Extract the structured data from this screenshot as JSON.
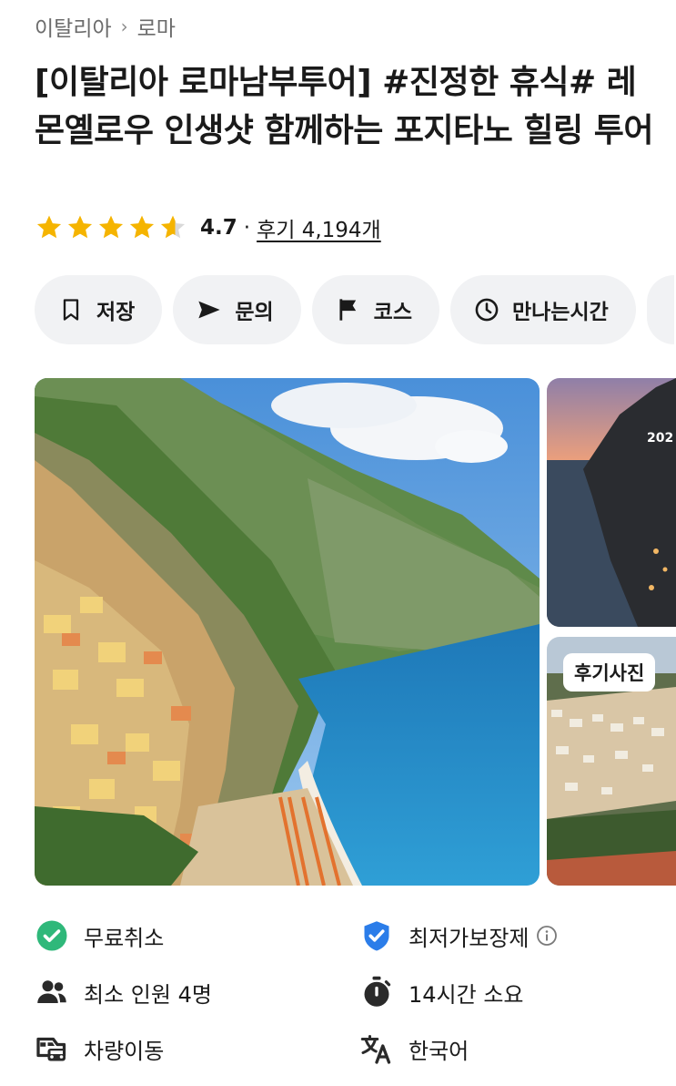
{
  "breadcrumb": {
    "country": "이탈리아",
    "city": "로마",
    "separator": "›"
  },
  "title": "[이탈리아 로마남부투어] #진정한 휴식# 레몬옐로우 인생샷 함께하는 포지타노 힐링 투어",
  "rating": {
    "stars": 4.7,
    "score": "4.7",
    "dot": "·",
    "reviews": "후기 4,194개",
    "star_color": "#f5b400"
  },
  "actions": [
    {
      "label": "저장",
      "icon": "bookmark-icon"
    },
    {
      "label": "문의",
      "icon": "send-icon"
    },
    {
      "label": "코스",
      "icon": "flag-icon"
    },
    {
      "label": "만나는시간",
      "icon": "clock-icon"
    }
  ],
  "gallery": {
    "review_badge": "후기사진",
    "award_text": "202"
  },
  "features": [
    {
      "label": "무료취소",
      "icon": "check-circle-icon",
      "color": "#2fb87a"
    },
    {
      "label": "최저가보장제",
      "icon": "shield-check-icon",
      "color": "#2b7de9",
      "info": "info-icon"
    },
    {
      "label": "최소 인원 4명",
      "icon": "people-icon"
    },
    {
      "label": "14시간 소요",
      "icon": "stopwatch-icon"
    },
    {
      "label": "차량이동",
      "icon": "car-icon"
    },
    {
      "label": "한국어",
      "icon": "translate-icon"
    }
  ]
}
